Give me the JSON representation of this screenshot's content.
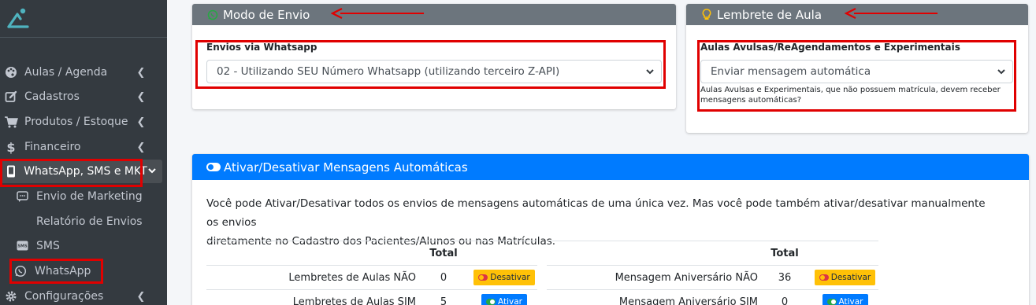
{
  "sidebar": {
    "items": [
      {
        "label": "Aulas / Agenda",
        "icon": "palette-icon"
      },
      {
        "label": "Cadastros",
        "icon": "edit-icon"
      },
      {
        "label": "Produtos / Estoque",
        "icon": "cart-icon"
      },
      {
        "label": "Financeiro",
        "icon": "dollar-icon"
      },
      {
        "label": "WhatsApp, SMS e MKT",
        "icon": "mobile-icon"
      },
      {
        "label": "Configurações",
        "icon": "gear-icon"
      }
    ],
    "subitems": [
      {
        "label": "Envio de Marketing",
        "icon": "comment-icon"
      },
      {
        "label": "Relatório de Envios",
        "icon": "document-icon"
      },
      {
        "label": "SMS",
        "icon": "sms-icon"
      },
      {
        "label": "WhatsApp",
        "icon": "whatsapp-icon"
      }
    ]
  },
  "modo_envio": {
    "title": "Modo de Envio",
    "field_label": "Envios via Whatsapp",
    "selected": "02 - Utilizando SEU Número Whatsapp (utilizando terceiro Z-API)"
  },
  "lembrete": {
    "title": "Lembrete de Aula",
    "field_label": "Aulas Avulsas/ReAgendamentos e Experimentais",
    "selected": "Enviar mensagem automática",
    "help_line1": "Aulas Avulsas e Experimentais, que não possuem matrícula, devem receber",
    "help_line2": "mensagens automáticas?"
  },
  "ativar": {
    "title": "Ativar/Desativar Mensagens Automáticas",
    "para_line1": "Você pode Ativar/Desativar todos os envios de mensagens automáticas de uma única vez. Mas você pode também ativar/desativar manualmente os envios",
    "para_line2": "diretamente no Cadastro dos Pacientes/Alunos ou nas Matrículas.",
    "total_header": "Total",
    "left_rows": [
      {
        "label": "Lembretes de Aulas NÃO",
        "total": "0",
        "button": "Desativar"
      },
      {
        "label": "Lembretes de Aulas SIM",
        "total": "5",
        "button": "Ativar"
      }
    ],
    "right_rows": [
      {
        "label": "Mensagem Aniversário NÃO",
        "total": "36",
        "button": "Desativar"
      },
      {
        "label": "Mensagem Aniversário SIM",
        "total": "0",
        "button": "Ativar"
      }
    ]
  },
  "colors": {
    "sidebar_bg": "#343a40",
    "header_gray": "#6c757d",
    "header_blue": "#007bff",
    "warning": "#ffc107",
    "highlight_red": "#e00000"
  }
}
